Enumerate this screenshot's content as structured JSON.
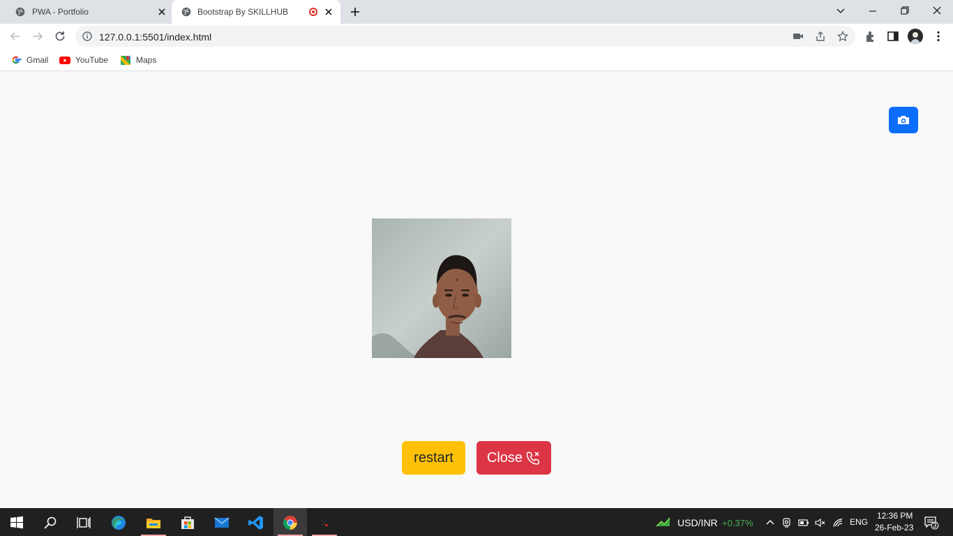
{
  "browser": {
    "tabs": [
      {
        "title": "PWA - Portfolio"
      },
      {
        "title": "Bootstrap By SKILLHUB"
      }
    ],
    "url": "127.0.0.1:5501/index.html",
    "bookmarks": [
      {
        "label": "Gmail"
      },
      {
        "label": "YouTube"
      },
      {
        "label": "Maps"
      }
    ]
  },
  "page": {
    "restart_label": "restart",
    "close_label": "Close",
    "accent_colors": {
      "primary": "#0d6efd",
      "warning": "#ffc107",
      "danger": "#dc3545"
    }
  },
  "taskbar": {
    "ticker_symbol": "USD/INR",
    "ticker_change": "+0.37%",
    "language": "ENG",
    "time": "12:36 PM",
    "date": "26-Feb-23",
    "notifications": "3"
  }
}
